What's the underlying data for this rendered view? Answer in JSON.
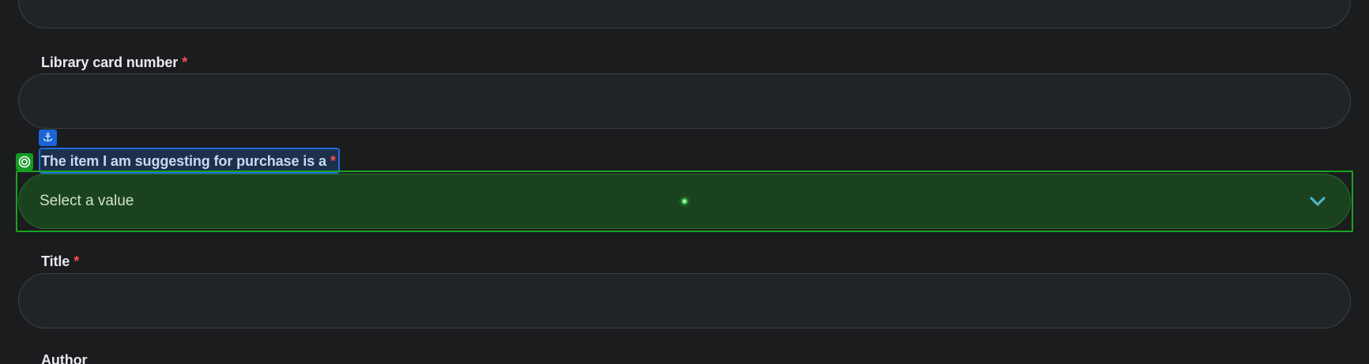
{
  "form": {
    "library_card": {
      "label": "Library card number",
      "required_marker": "*",
      "value": ""
    },
    "item_type": {
      "label": "The item I am suggesting for purchase is a",
      "required_marker": "*",
      "placeholder": "Select a value"
    },
    "title": {
      "label": "Title",
      "required_marker": "*",
      "value": ""
    },
    "author": {
      "label": "Author"
    }
  },
  "overlays": {
    "anchor_icon": "anchor-icon",
    "target_icon": "target-icon",
    "label_highlight_color": "#1f6bd8",
    "select_highlight_color": "#16a521"
  },
  "colors": {
    "background": "#1b1c1e",
    "input_bg": "#212426",
    "required": "#ff4d4d",
    "chevron": "#4fb3c4"
  }
}
